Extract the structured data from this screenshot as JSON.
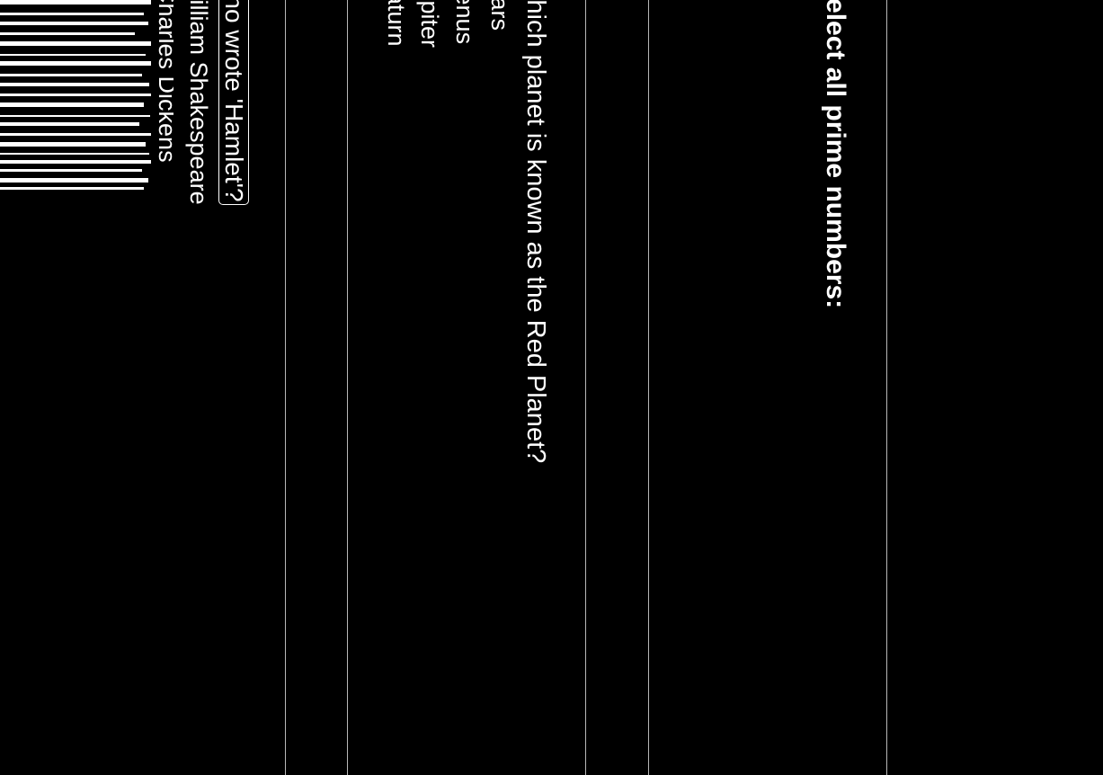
{
  "questions": [
    {
      "text": "Select all prime numbers:"
    },
    {
      "text": "Which planet is known as the Red Planet?",
      "options": [
        "Mars",
        "Venus",
        "Jupiter",
        "Saturn"
      ]
    },
    {
      "text": "Who wrote 'Hamlet'?",
      "options": [
        "William Shakespeare",
        "Charles Dickens"
      ]
    }
  ],
  "colors": {
    "background": "#000000",
    "text": "#ffffff",
    "divider": "#b8b8b8"
  }
}
